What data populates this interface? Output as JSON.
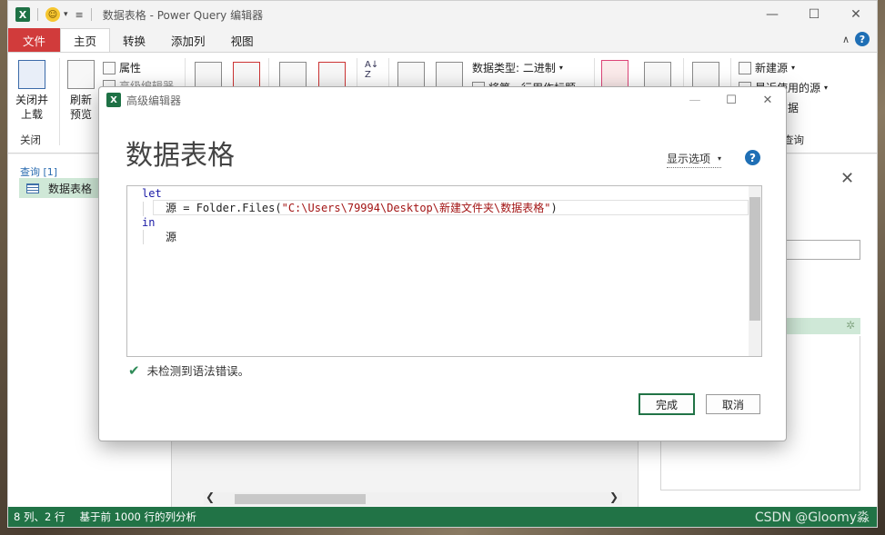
{
  "app": {
    "title": "数据表格 - Power Query 编辑器",
    "tabs": [
      "文件",
      "主页",
      "转换",
      "添加列",
      "视图"
    ]
  },
  "ribbon": {
    "close_load": "关闭并\n上载",
    "close_group": "关闭",
    "refresh": "刷新\n预览",
    "properties": "属性",
    "advanced_editor": "高级编辑器",
    "data_type": "数据类型: 二进制",
    "first_row_header": "将第一行用作标题",
    "new_source": "新建源",
    "recent_sources": "最近使用的源",
    "data_label": "据",
    "query_group": "查询"
  },
  "query_pane": {
    "header": "查询 [1]",
    "items": [
      "数据表格"
    ]
  },
  "status_bar": {
    "columns_rows": "8 列、2 行",
    "profile": "基于前 1000 行的列分析",
    "watermark": "CSDN @Gloomy淼"
  },
  "modal": {
    "title": "高级编辑器",
    "query_name": "数据表格",
    "display_options": "显示选项",
    "code": {
      "line1": "let",
      "line2_var": "源",
      "line2_eq": " = Folder.Files(",
      "line2_str": "\"C:\\Users\\79994\\Desktop\\新建文件夹\\数据表格\"",
      "line2_end": ")",
      "line3": "in",
      "line4": "源"
    },
    "syntax_status": "未检测到语法错误。",
    "done_label": "完成",
    "cancel_label": "取消"
  },
  "colors": {
    "excel_green": "#217346",
    "file_tab_red": "#d13b3b",
    "help_blue": "#1f6fb5",
    "selection_green": "#cfe8d7"
  }
}
